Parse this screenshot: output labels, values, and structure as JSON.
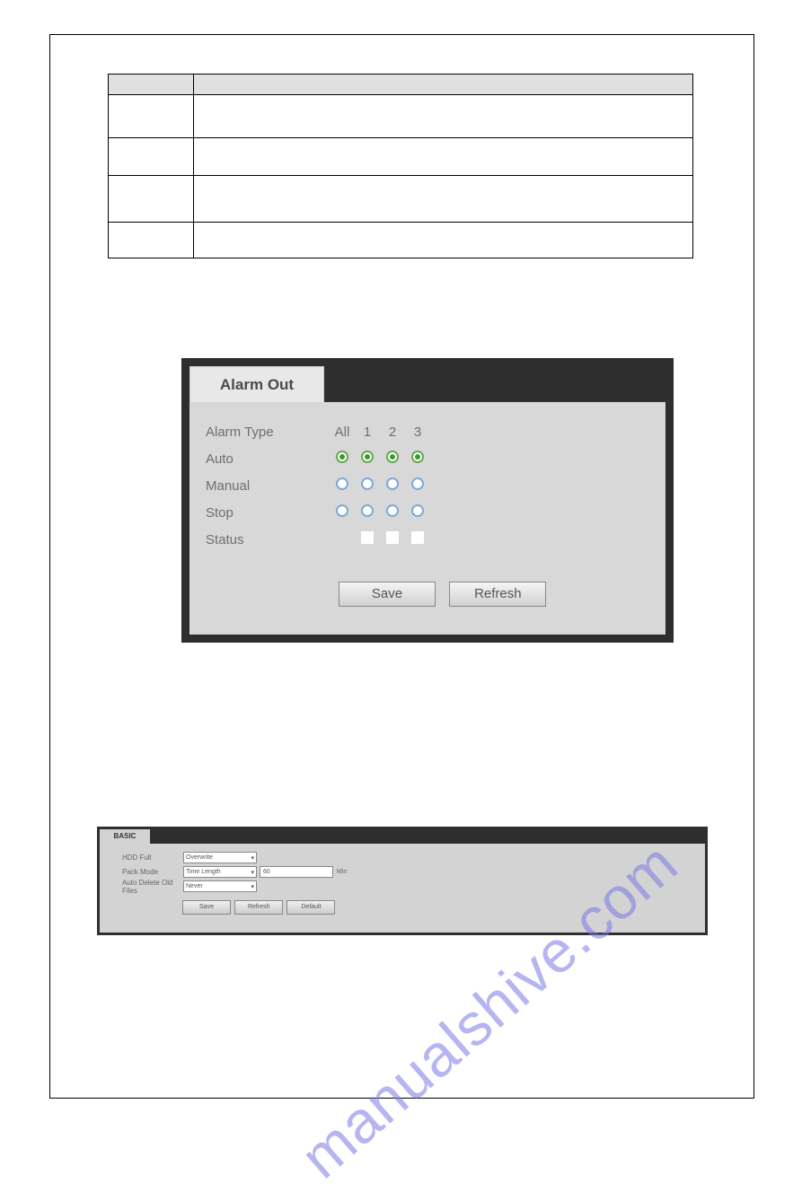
{
  "watermark": "manualshive.com",
  "table": {
    "headers": [
      "",
      ""
    ],
    "rows": [
      [
        "",
        ""
      ],
      [
        "",
        ""
      ],
      [
        "",
        ""
      ],
      [
        "",
        ""
      ]
    ]
  },
  "alarm_out": {
    "tab_label": "Alarm Out",
    "header_label": "Alarm Type",
    "columns": [
      "All",
      "1",
      "2",
      "3"
    ],
    "rows": [
      {
        "label": "Auto",
        "type": "radio-green",
        "selected": [
          true,
          true,
          true,
          true
        ]
      },
      {
        "label": "Manual",
        "type": "radio-blue",
        "selected": [
          false,
          false,
          false,
          false
        ]
      },
      {
        "label": "Stop",
        "type": "radio-blue",
        "selected": [
          false,
          false,
          false,
          false
        ]
      },
      {
        "label": "Status",
        "type": "checkbox",
        "selected": [
          null,
          false,
          false,
          false
        ]
      }
    ],
    "buttons": {
      "save": "Save",
      "refresh": "Refresh"
    }
  },
  "basic": {
    "tab_label": "BASIC",
    "fields": {
      "hdd_full": {
        "label": "HDD Full",
        "value": "Overwrite"
      },
      "pack_mode": {
        "label": "Pack Mode",
        "value": "Time Length",
        "input": "60",
        "unit": "Min"
      },
      "auto_delete": {
        "label": "Auto Delete Old Files",
        "value": "Never"
      }
    },
    "buttons": {
      "save": "Save",
      "refresh": "Refresh",
      "default": "Default"
    }
  }
}
